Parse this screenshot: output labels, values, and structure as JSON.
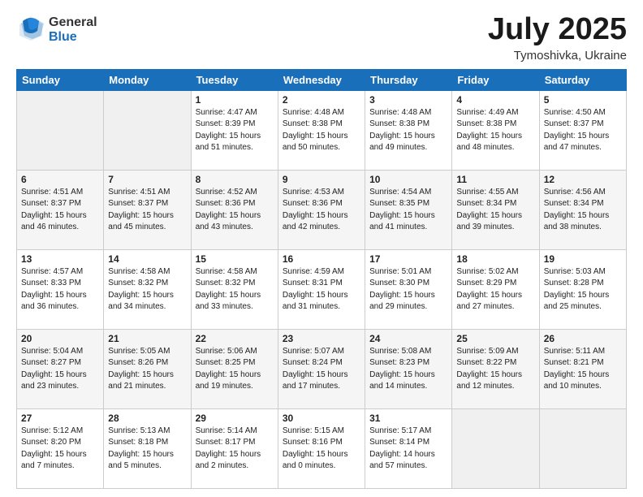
{
  "header": {
    "logo_general": "General",
    "logo_blue": "Blue",
    "month_title": "July 2025",
    "subtitle": "Tymoshivka, Ukraine"
  },
  "weekdays": [
    "Sunday",
    "Monday",
    "Tuesday",
    "Wednesday",
    "Thursday",
    "Friday",
    "Saturday"
  ],
  "weeks": [
    [
      {
        "day": "",
        "info": ""
      },
      {
        "day": "",
        "info": ""
      },
      {
        "day": "1",
        "info": "Sunrise: 4:47 AM\nSunset: 8:39 PM\nDaylight: 15 hours\nand 51 minutes."
      },
      {
        "day": "2",
        "info": "Sunrise: 4:48 AM\nSunset: 8:38 PM\nDaylight: 15 hours\nand 50 minutes."
      },
      {
        "day": "3",
        "info": "Sunrise: 4:48 AM\nSunset: 8:38 PM\nDaylight: 15 hours\nand 49 minutes."
      },
      {
        "day": "4",
        "info": "Sunrise: 4:49 AM\nSunset: 8:38 PM\nDaylight: 15 hours\nand 48 minutes."
      },
      {
        "day": "5",
        "info": "Sunrise: 4:50 AM\nSunset: 8:37 PM\nDaylight: 15 hours\nand 47 minutes."
      }
    ],
    [
      {
        "day": "6",
        "info": "Sunrise: 4:51 AM\nSunset: 8:37 PM\nDaylight: 15 hours\nand 46 minutes."
      },
      {
        "day": "7",
        "info": "Sunrise: 4:51 AM\nSunset: 8:37 PM\nDaylight: 15 hours\nand 45 minutes."
      },
      {
        "day": "8",
        "info": "Sunrise: 4:52 AM\nSunset: 8:36 PM\nDaylight: 15 hours\nand 43 minutes."
      },
      {
        "day": "9",
        "info": "Sunrise: 4:53 AM\nSunset: 8:36 PM\nDaylight: 15 hours\nand 42 minutes."
      },
      {
        "day": "10",
        "info": "Sunrise: 4:54 AM\nSunset: 8:35 PM\nDaylight: 15 hours\nand 41 minutes."
      },
      {
        "day": "11",
        "info": "Sunrise: 4:55 AM\nSunset: 8:34 PM\nDaylight: 15 hours\nand 39 minutes."
      },
      {
        "day": "12",
        "info": "Sunrise: 4:56 AM\nSunset: 8:34 PM\nDaylight: 15 hours\nand 38 minutes."
      }
    ],
    [
      {
        "day": "13",
        "info": "Sunrise: 4:57 AM\nSunset: 8:33 PM\nDaylight: 15 hours\nand 36 minutes."
      },
      {
        "day": "14",
        "info": "Sunrise: 4:58 AM\nSunset: 8:32 PM\nDaylight: 15 hours\nand 34 minutes."
      },
      {
        "day": "15",
        "info": "Sunrise: 4:58 AM\nSunset: 8:32 PM\nDaylight: 15 hours\nand 33 minutes."
      },
      {
        "day": "16",
        "info": "Sunrise: 4:59 AM\nSunset: 8:31 PM\nDaylight: 15 hours\nand 31 minutes."
      },
      {
        "day": "17",
        "info": "Sunrise: 5:01 AM\nSunset: 8:30 PM\nDaylight: 15 hours\nand 29 minutes."
      },
      {
        "day": "18",
        "info": "Sunrise: 5:02 AM\nSunset: 8:29 PM\nDaylight: 15 hours\nand 27 minutes."
      },
      {
        "day": "19",
        "info": "Sunrise: 5:03 AM\nSunset: 8:28 PM\nDaylight: 15 hours\nand 25 minutes."
      }
    ],
    [
      {
        "day": "20",
        "info": "Sunrise: 5:04 AM\nSunset: 8:27 PM\nDaylight: 15 hours\nand 23 minutes."
      },
      {
        "day": "21",
        "info": "Sunrise: 5:05 AM\nSunset: 8:26 PM\nDaylight: 15 hours\nand 21 minutes."
      },
      {
        "day": "22",
        "info": "Sunrise: 5:06 AM\nSunset: 8:25 PM\nDaylight: 15 hours\nand 19 minutes."
      },
      {
        "day": "23",
        "info": "Sunrise: 5:07 AM\nSunset: 8:24 PM\nDaylight: 15 hours\nand 17 minutes."
      },
      {
        "day": "24",
        "info": "Sunrise: 5:08 AM\nSunset: 8:23 PM\nDaylight: 15 hours\nand 14 minutes."
      },
      {
        "day": "25",
        "info": "Sunrise: 5:09 AM\nSunset: 8:22 PM\nDaylight: 15 hours\nand 12 minutes."
      },
      {
        "day": "26",
        "info": "Sunrise: 5:11 AM\nSunset: 8:21 PM\nDaylight: 15 hours\nand 10 minutes."
      }
    ],
    [
      {
        "day": "27",
        "info": "Sunrise: 5:12 AM\nSunset: 8:20 PM\nDaylight: 15 hours\nand 7 minutes."
      },
      {
        "day": "28",
        "info": "Sunrise: 5:13 AM\nSunset: 8:18 PM\nDaylight: 15 hours\nand 5 minutes."
      },
      {
        "day": "29",
        "info": "Sunrise: 5:14 AM\nSunset: 8:17 PM\nDaylight: 15 hours\nand 2 minutes."
      },
      {
        "day": "30",
        "info": "Sunrise: 5:15 AM\nSunset: 8:16 PM\nDaylight: 15 hours\nand 0 minutes."
      },
      {
        "day": "31",
        "info": "Sunrise: 5:17 AM\nSunset: 8:14 PM\nDaylight: 14 hours\nand 57 minutes."
      },
      {
        "day": "",
        "info": ""
      },
      {
        "day": "",
        "info": ""
      }
    ]
  ]
}
